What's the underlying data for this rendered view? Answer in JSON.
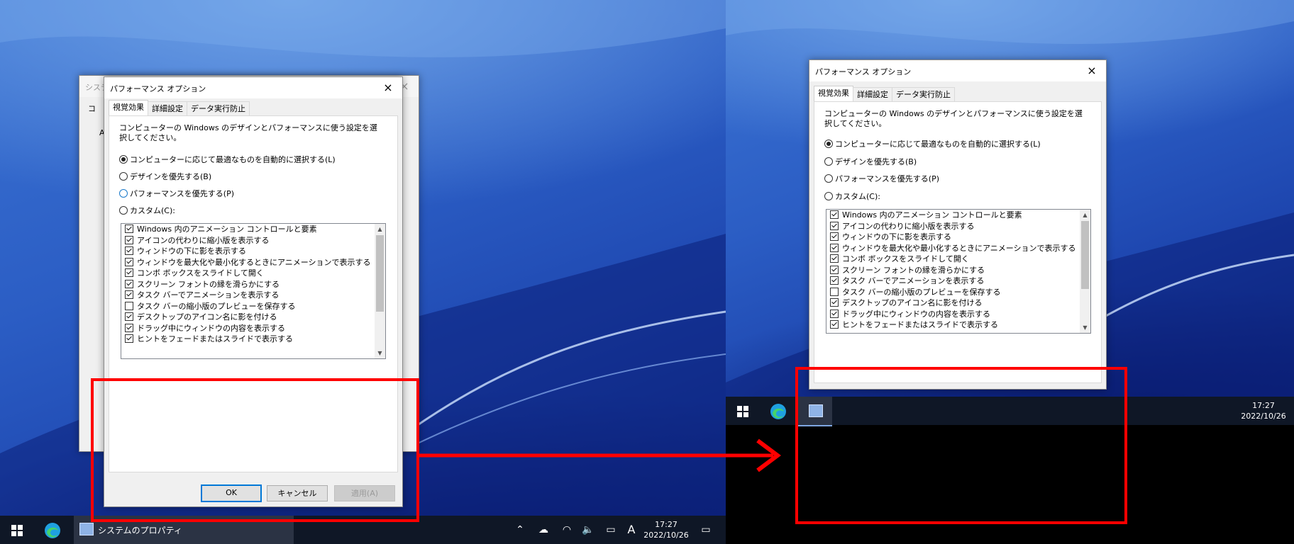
{
  "colors": {
    "annotation_red": "#ff0000",
    "accent": "#0078d7",
    "taskbar": "#0f1726"
  },
  "left": {
    "bg_window": {
      "title": "システムのプロパティ",
      "tab": "コ",
      "side_letter": "A"
    },
    "dialog": {
      "title": "パフォーマンス オプション",
      "close_icon": "×",
      "tabs": [
        "視覚効果",
        "詳細設定",
        "データ実行防止"
      ],
      "description": "コンピューターの Windows のデザインとパフォーマンスに使う設定を選択してください。",
      "radios": [
        {
          "label": "コンピューターに応じて最適なものを自動的に選択する(L)",
          "checked": true
        },
        {
          "label": "デザインを優先する(B)",
          "checked": false
        },
        {
          "label": "パフォーマンスを優先する(P)",
          "checked": false
        },
        {
          "label": "カスタム(C):",
          "checked": false
        }
      ],
      "items": [
        {
          "label": "Windows 内のアニメーション コントロールと要素",
          "checked": true
        },
        {
          "label": "アイコンの代わりに縮小版を表示する",
          "checked": true
        },
        {
          "label": "ウィンドウの下に影を表示する",
          "checked": true
        },
        {
          "label": "ウィンドウを最大化や最小化するときにアニメーションで表示する",
          "checked": true
        },
        {
          "label": "コンボ ボックスをスライドして開く",
          "checked": true
        },
        {
          "label": "スクリーン フォントの縁を滑らかにする",
          "checked": true
        },
        {
          "label": "タスク バーでアニメーションを表示する",
          "checked": true
        },
        {
          "label": "タスク バーの縮小版のプレビューを保存する",
          "checked": false
        },
        {
          "label": "デスクトップのアイコン名に影を付ける",
          "checked": true
        },
        {
          "label": "ドラッグ中にウィンドウの内容を表示する",
          "checked": true
        },
        {
          "label": "ヒントをフェードまたはスライドで表示する",
          "checked": true
        }
      ],
      "ok": "OK",
      "cancel": "キャンセル",
      "apply": "適用(A)"
    },
    "taskbar": {
      "app_label": "システムのプロパティ",
      "time": "17:27",
      "date": "2022/10/26",
      "ime": "A"
    }
  },
  "right": {
    "dialog": {
      "title": "パフォーマンス オプション",
      "close_icon": "×",
      "tabs": [
        "視覚効果",
        "詳細設定",
        "データ実行防止"
      ],
      "description": "コンピューターの Windows のデザインとパフォーマンスに使う設定を選択してください。",
      "radios": [
        {
          "label": "コンピューターに応じて最適なものを自動的に選択する(L)",
          "checked": true
        },
        {
          "label": "デザインを優先する(B)",
          "checked": false
        },
        {
          "label": "パフォーマンスを優先する(P)",
          "checked": false
        },
        {
          "label": "カスタム(C):",
          "checked": false
        }
      ],
      "items": [
        {
          "label": "Windows 内のアニメーション コントロールと要素",
          "checked": true
        },
        {
          "label": "アイコンの代わりに縮小版を表示する",
          "checked": true
        },
        {
          "label": "ウィンドウの下に影を表示する",
          "checked": true
        },
        {
          "label": "ウィンドウを最大化や最小化するときにアニメーションで表示する",
          "checked": true
        },
        {
          "label": "コンボ ボックスをスライドして開く",
          "checked": true
        },
        {
          "label": "スクリーン フォントの縁を滑らかにする",
          "checked": true
        },
        {
          "label": "タスク バーでアニメーションを表示する",
          "checked": true
        },
        {
          "label": "タスク バーの縮小版のプレビューを保存する",
          "checked": false
        },
        {
          "label": "デスクトップのアイコン名に影を付ける",
          "checked": true
        },
        {
          "label": "ドラッグ中にウィンドウの内容を表示する",
          "checked": true
        },
        {
          "label": "ヒントをフェードまたはスライドで表示する",
          "checked": true
        }
      ]
    },
    "taskbar": {
      "time": "17:27",
      "date": "2022/10/26"
    }
  }
}
